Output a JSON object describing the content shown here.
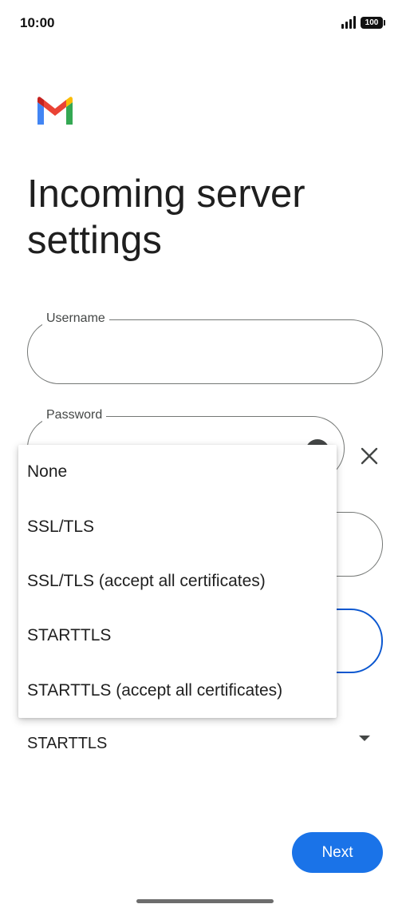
{
  "status_bar": {
    "time": "10:00",
    "battery": "100",
    "signal_icon": "signal-icon"
  },
  "app": {
    "logo_icon": "gmail-logo-icon"
  },
  "page": {
    "title": "Incoming server settings"
  },
  "form": {
    "username": {
      "label": "Username",
      "value": ""
    },
    "password": {
      "label": "Password",
      "value": "",
      "toggle_icon": "visibility-icon"
    },
    "clear_icon": "close-icon",
    "security": {
      "selected": "STARTTLS",
      "arrow_icon": "dropdown-arrow-icon"
    }
  },
  "security_menu": {
    "items": [
      {
        "label": "None"
      },
      {
        "label": "SSL/TLS"
      },
      {
        "label": "SSL/TLS (accept all certificates)"
      },
      {
        "label": "STARTTLS"
      },
      {
        "label": "STARTTLS (accept all certificates)"
      }
    ]
  },
  "actions": {
    "next_label": "Next"
  },
  "colors": {
    "primary": "#1a73e8",
    "focus_outline": "#0b57d0",
    "outline": "#747775"
  }
}
